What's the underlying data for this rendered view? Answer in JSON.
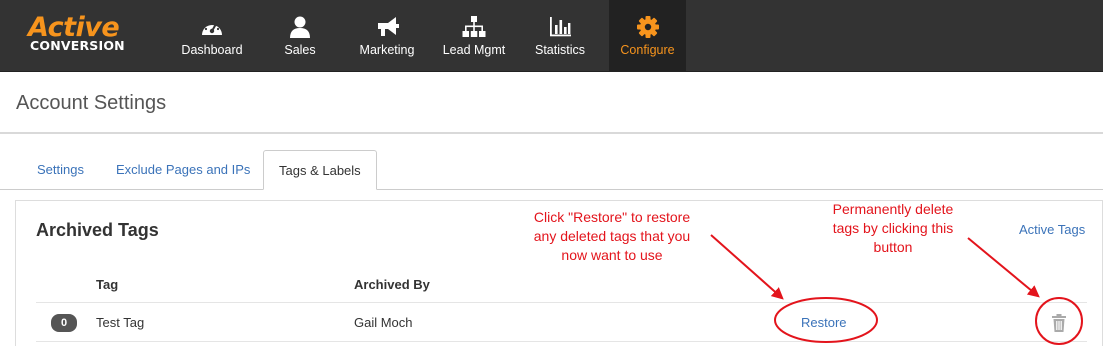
{
  "brand": {
    "line1": "Active",
    "line2": "CONVERSION"
  },
  "nav": [
    {
      "label": "Dashboard",
      "icon": "dashboard-gauge-icon"
    },
    {
      "label": "Sales",
      "icon": "user-icon"
    },
    {
      "label": "Marketing",
      "icon": "megaphone-icon"
    },
    {
      "label": "Lead Mgmt",
      "icon": "sitemap-icon"
    },
    {
      "label": "Statistics",
      "icon": "bar-chart-icon"
    },
    {
      "label": "Configure",
      "icon": "gear-icon",
      "active": true
    }
  ],
  "page": {
    "title": "Account Settings"
  },
  "tabs": [
    {
      "label": "Settings"
    },
    {
      "label": "Exclude Pages and IPs"
    },
    {
      "label": "Tags & Labels",
      "active": true
    }
  ],
  "panel": {
    "title": "Archived Tags",
    "active_tags_link": "Active Tags",
    "columns": {
      "tag": "Tag",
      "archived_by": "Archived By"
    },
    "rows": [
      {
        "count": "0",
        "tag": "Test Tag",
        "archived_by": "Gail Moch",
        "action": "Restore",
        "delete_icon": "trash-icon"
      }
    ]
  },
  "annotations": {
    "restore_note": [
      "Click \"Restore\" to restore",
      "any deleted tags that you",
      "now want to use"
    ],
    "delete_note": [
      "Permanently delete",
      "tags by clicking this",
      "button"
    ]
  },
  "colors": {
    "brand_orange": "#f7941d",
    "topbar": "#333333",
    "link_blue": "#3b73b9",
    "annotation_red": "#e3141c"
  }
}
